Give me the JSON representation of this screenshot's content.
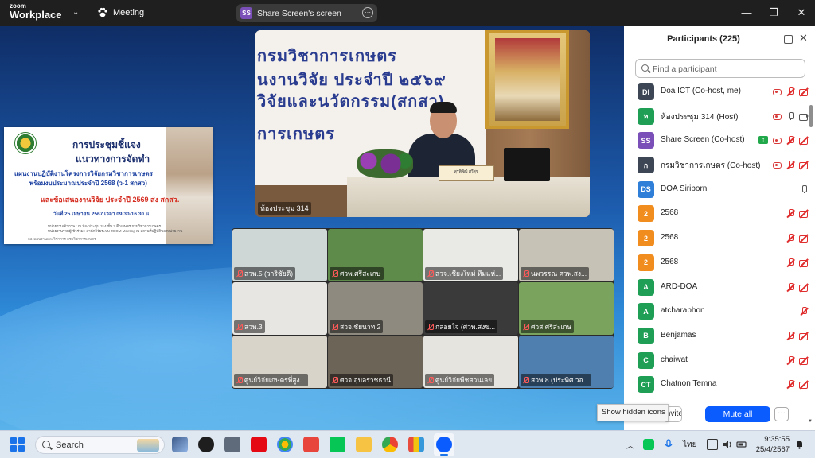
{
  "titlebar": {
    "logo_line1": "zoom",
    "logo_line2": "Workplace",
    "meeting_label": "Meeting",
    "share_avatar": "SS",
    "share_title": "Share Screen's screen",
    "more_glyph": "···",
    "minimize_glyph": "—",
    "maximize_glyph": "❐",
    "close_glyph": "✕"
  },
  "slide": {
    "title_line1": "การประชุมชี้แจง",
    "title_line2": "แนวทางการจัดทำ",
    "line3": "แผนงานปฏิบัติงานโครงการวิจัยกรมวิชาการเกษตร",
    "line4": "พร้อมงบประมาณประจำปี 2568 (ว-1 สกสว)",
    "line5": "และข้อเสนองานวิจัย ประจำปี 2569 ส่ง สกสว.",
    "date_line": "วันที่ 25 เมษายน 2567 เวลา 09.30-16.30 น.",
    "fine1": "หน่วยงานเจ้าภาพ : ณ ห้องประชุม 314 ชั้น 3 ตึกเกษตร กรมวิชาการเกษตร",
    "fine2": "หน่วยงานร่วมผู้เข้าร่วม : สำนักวิจัยระบบ ZOOM Meeting ณ สถานที่ปฏิบัติของหน่วยงาน",
    "fine3": "กองแผนงานและวิชาการ กรมวิชาการเกษตร"
  },
  "main_video": {
    "banner_line1": "กรมวิชาการเกษตร",
    "banner_line2": "นงานวิจัย ประจำปี ๒๕๖๙",
    "banner_line3": "วิจัยและนวัตกรรม(สกสว)",
    "banner_line4": "การเกษตร",
    "nameplate": "สุรพิพัฒ์ ศรีสุข",
    "label": "ห้องประชุม 314"
  },
  "gallery": [
    {
      "label": "สวพ.5 (วาริชัยดี)",
      "bg": "#cfd6d6"
    },
    {
      "label": "ศวพ.ศรีสะเกษ",
      "bg": "#5e8a4a"
    },
    {
      "label": "สวจ.เชียงใหม่ ทีมแห่...",
      "bg": "#e9e9e6"
    },
    {
      "label": "นพวรรณ ศวพ.สง...",
      "bg": "#c7c2b6"
    },
    {
      "label": "สวพ.3",
      "bg": "#e8e6e2"
    },
    {
      "label": "สวจ.ชัยนาท 2",
      "bg": "#8f8a80"
    },
    {
      "label": "กลอยใจ (ศวพ.สงข...",
      "bg": "#3a3a3a"
    },
    {
      "label": "ศวส.ศรีสะเกษ",
      "bg": "#7aa45e"
    },
    {
      "label": "ศูนย์วิจัยเกษตรที่สูง...",
      "bg": "#d9d4c9"
    },
    {
      "label": "ศวจ.อุบลราชธานี",
      "bg": "#6c6456"
    },
    {
      "label": "ศูนย์วิจัยพืชสวนเลย",
      "bg": "#e6e4df"
    },
    {
      "label": "สวพ.8 (ประพิศ วอ...",
      "bg": "#4f7faf"
    }
  ],
  "participants": {
    "title": "Participants (225)",
    "search_placeholder": "Find a participant",
    "invite_label": "Invite",
    "mute_all_label": "Mute all",
    "more_label": "···",
    "items": [
      {
        "initials": "DI",
        "name": "Doa ICT (Co-host, me)",
        "color": "#3c4654",
        "icons": [
          "rec",
          "micoff",
          "camoff"
        ]
      },
      {
        "initials": "ห",
        "name": "ห้องประชุม 314 (Host)",
        "color": "#1f9e55",
        "icons": [
          "rec",
          "mic",
          "cam"
        ]
      },
      {
        "initials": "SS",
        "name": "Share Screen (Co-host)",
        "color": "#7b4fb8",
        "icons": [
          "share",
          "rec",
          "micoff",
          "camoff"
        ]
      },
      {
        "initials": "ก",
        "name": "กรมวิชาการเกษตร (Co-host)",
        "color": "#3c4654",
        "icons": [
          "rec",
          "micoff",
          "camoff"
        ]
      },
      {
        "initials": "DS",
        "name": "DOA Siriporn",
        "color": "#2f7fd8",
        "icons": [
          "mic"
        ]
      },
      {
        "initials": "2",
        "name": "2568",
        "color": "#f18c1e",
        "icons": [
          "micoff",
          "camoff"
        ]
      },
      {
        "initials": "2",
        "name": "2568",
        "color": "#f18c1e",
        "icons": [
          "micoff",
          "camoff"
        ]
      },
      {
        "initials": "2",
        "name": "2568",
        "color": "#f18c1e",
        "icons": [
          "micoff",
          "camoff"
        ]
      },
      {
        "initials": "A",
        "name": "ARD-DOA",
        "color": "#1f9e55",
        "icons": [
          "micoff",
          "camoff"
        ]
      },
      {
        "initials": "A",
        "name": "atcharaphon",
        "color": "#1f9e55",
        "icons": [
          "micoff"
        ]
      },
      {
        "initials": "B",
        "name": "Benjamas",
        "color": "#1f9e55",
        "icons": [
          "micoff",
          "camoff"
        ]
      },
      {
        "initials": "C",
        "name": "chaiwat",
        "color": "#1f9e55",
        "icons": [
          "micoff",
          "camoff"
        ]
      },
      {
        "initials": "CT",
        "name": "Chatnon Temna",
        "color": "#1f9e55",
        "icons": [
          "micoff",
          "camoff"
        ]
      }
    ]
  },
  "tooltip": "Show hidden icons",
  "taskbar": {
    "search_label": "Search",
    "lang": "ไทย",
    "time": "9:35:55",
    "date": "25/4/2567"
  }
}
